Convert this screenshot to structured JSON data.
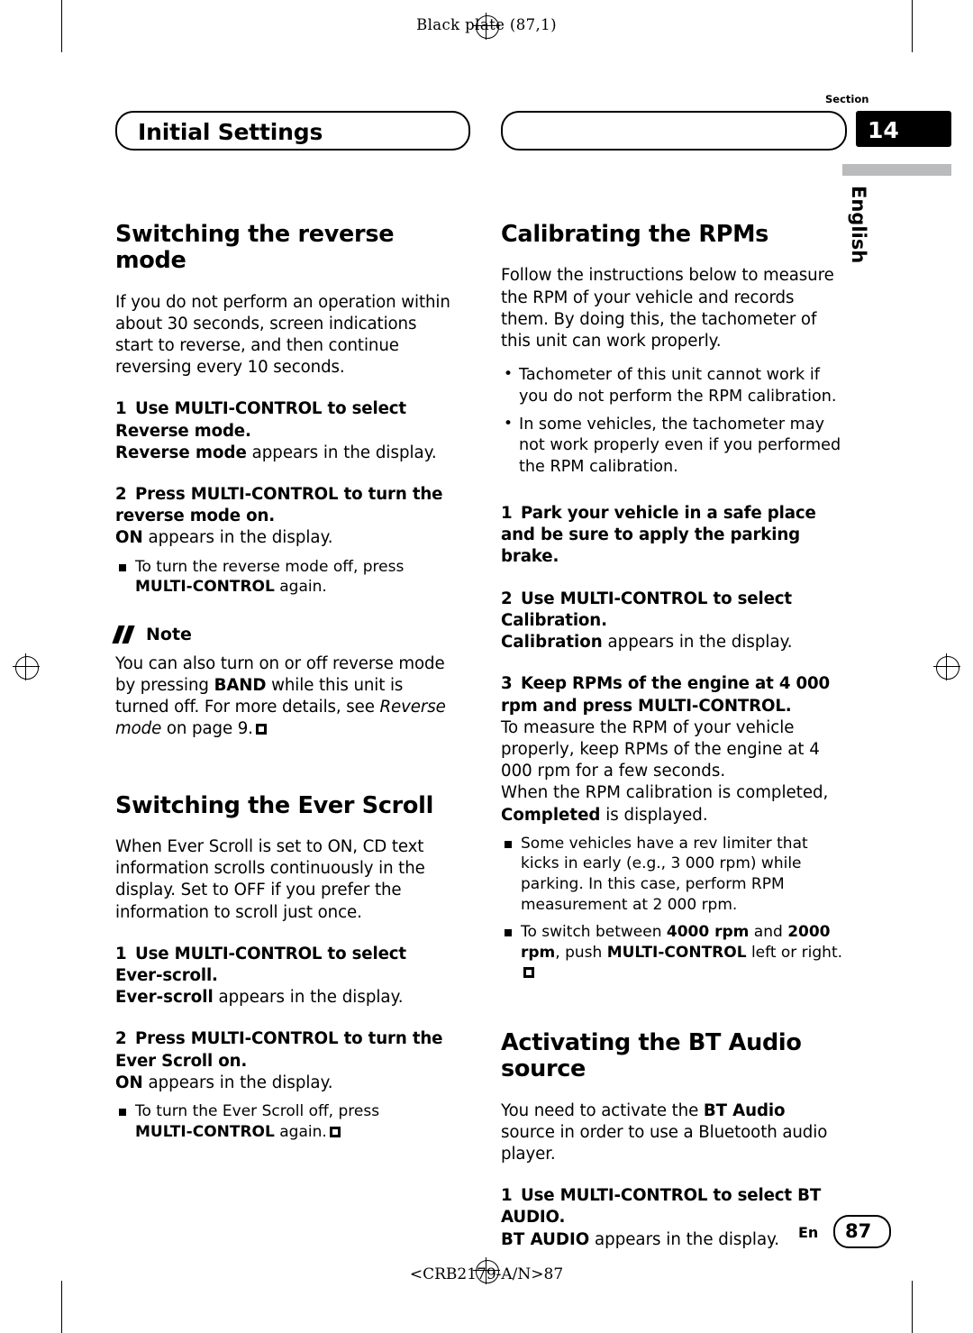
{
  "page": {
    "plate": "Black plate (87,1)",
    "section_label": "Section",
    "section_number": "14",
    "language_tab": "English",
    "title": "Initial Settings",
    "footer_en": "En",
    "footer_page": "87",
    "footer_code": "<CRB2179-A/N>87"
  },
  "left_column": {
    "heading1": "Switching the reverse mode",
    "intro1": "If you do not perform an operation within about 30 seconds, screen indications start to reverse, and then continue reversing every 10 seconds.",
    "step1_num": "1",
    "step1_text": "Use MULTI-CONTROL to select Reverse mode.",
    "step1_after_bold": "Reverse mode",
    "step1_after_rest": " appears in the display.",
    "step2_num": "2",
    "step2_text": "Press MULTI-CONTROL to turn the reverse mode on.",
    "step2_after_bold": "ON",
    "step2_after_rest": " appears in the display.",
    "step2_bullet_a": "To turn the reverse mode off, press",
    "step2_bullet_b_bold": "MULTI-CONTROL",
    "step2_bullet_b_rest": " again.",
    "note_label": "Note",
    "note_text_1": "You can also turn on or off reverse mode by pressing ",
    "note_band": "BAND",
    "note_text_2": " while this unit is turned off. For more details, see ",
    "note_italic": "Reverse mode",
    "note_text_3": " on page 9.",
    "heading2": "Switching the Ever Scroll",
    "intro2": "When Ever Scroll is set to ON, CD text information scrolls continuously in the display. Set to OFF if you prefer the information to scroll just once.",
    "step3_num": "1",
    "step3_text": "Use MULTI-CONTROL to select Ever-scroll.",
    "step3_after_bold": "Ever-scroll",
    "step3_after_rest": " appears in the display.",
    "step4_num": "2",
    "step4_text": "Press MULTI-CONTROL to turn the Ever Scroll on.",
    "step4_after_bold": "ON",
    "step4_after_rest": " appears in the display.",
    "step4_bullet_a": "To turn the Ever Scroll off, press",
    "step4_bullet_b_bold": "MULTI-CONTROL",
    "step4_bullet_b_rest": " again."
  },
  "right_column": {
    "heading1": "Calibrating the RPMs",
    "intro1": "Follow the instructions below to measure the RPM of your vehicle and records them. By doing this, the tachometer of this unit can work properly.",
    "dot1": "Tachometer of this unit cannot work if you do not perform the RPM calibration.",
    "dot2": "In some vehicles, the tachometer may not work properly even if you performed the RPM calibration.",
    "step1_num": "1",
    "step1_text": "Park your vehicle in a safe place and be sure to apply the parking brake.",
    "step2_num": "2",
    "step2_text": "Use MULTI-CONTROL to select Calibration.",
    "step2_after_bold": "Calibration",
    "step2_after_rest": " appears in the display.",
    "step3_num": "3",
    "step3_text": "Keep RPMs of the engine at 4 000 rpm and press MULTI-CONTROL.",
    "step3_after": "To measure the RPM of your vehicle properly, keep RPMs of the engine at 4 000 rpm for a few seconds.",
    "step3_after2_a": "When the RPM calibration is completed, ",
    "step3_after2_bold": "Completed",
    "step3_after2_b": " is displayed.",
    "bullet1": "Some vehicles have a rev limiter that kicks in early (e.g., 3 000 rpm) while parking. In this case, perform RPM measurement at 2 000 rpm.",
    "bullet2_a": "To switch between ",
    "bullet2_b1": "4000 rpm",
    "bullet2_mid": " and ",
    "bullet2_b2": "2000 rpm",
    "bullet2_c": ", push ",
    "bullet2_b3": "MULTI-CONTROL",
    "bullet2_d": " left or right.",
    "heading2_a": "Activating the ",
    "heading2_b": "BT Audio",
    "heading2_c": " source",
    "intro2_a": "You need to activate the ",
    "intro2_bold": "BT Audio",
    "intro2_b": " source in order to use a Bluetooth audio player.",
    "step4_num": "1",
    "step4_text": "Use MULTI-CONTROL to select BT AUDIO.",
    "step4_after_bold": "BT AUDIO",
    "step4_after_rest": " appears in the display."
  }
}
